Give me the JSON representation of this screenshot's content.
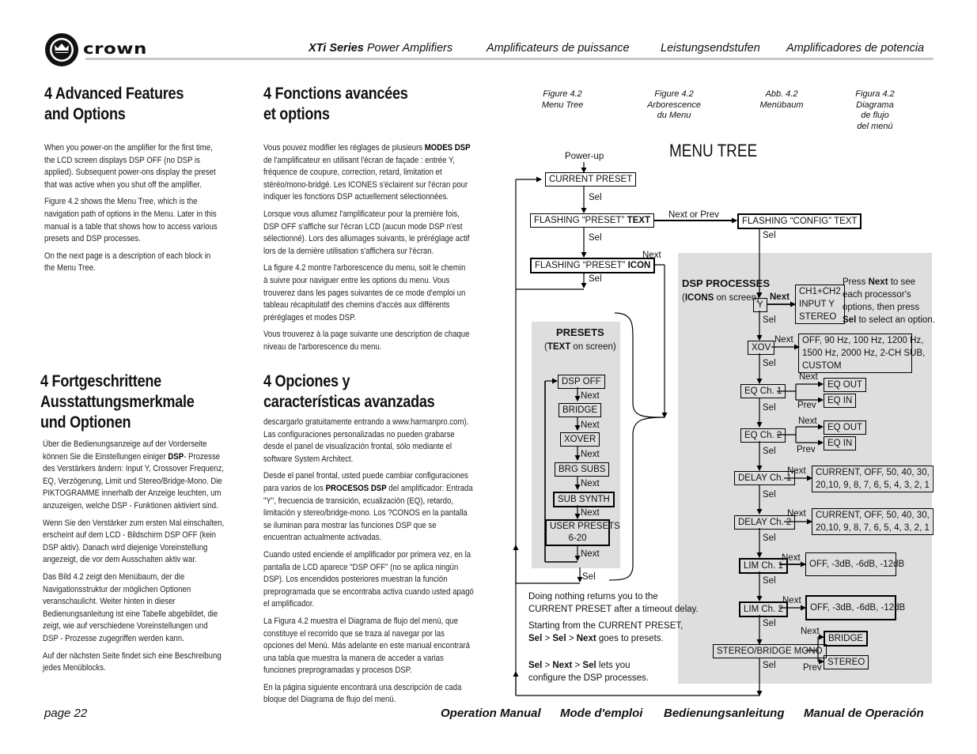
{
  "header": {
    "brand": "crown",
    "series_bold": "XTi Series",
    "series_rest": " Power Amplifiers",
    "fr": "Amplificateurs de puissance",
    "de": "Leistungsendstufen",
    "es": "Amplificadores de potencia"
  },
  "sections": {
    "en": {
      "title_line1": "4 Advanced Features",
      "title_line2": "and Options",
      "paragraphs": [
        "When you power-on the amplifier for the first time, the LCD screen displays DSP OFF (no DSP is applied). Subsequent power-ons display the preset that was active when you shut off the amplifier.",
        "Figure 4.2 shows the Menu Tree, which is the navigation path of options in the Menu. Later in this manual is a table that shows how to access various presets and DSP processes.",
        "On the next page is a description of each block in the Menu Tree."
      ]
    },
    "fr": {
      "title_line1": "4 Fonctions avancées",
      "title_line2": "et options",
      "p1_pre": "Vous pouvez modifier les réglages de plusieurs ",
      "p1_bold": "MODES DSP",
      "p1_post": " de l'amplificateur en utilisant l'écran de façade : entrée Y, fréquence de coupure, correction, retard, limitation et stéréo/mono-bridgé. Les ICONES s'éclairent sur l'écran pour indiquer les fonctions DSP actuellement sélectionnées.",
      "paragraphs": [
        "Lorsque vous allumez l'amplificateur pour la première fois, DSP OFF s'affiche sur l'écran LCD (aucun mode DSP n'est sélectionné). Lors des allumages suivants, le préréglage actif lors de la dernière utilisation s'affichera sur l'écran.",
        "La figure 4.2 montre l'arborescence du menu, soit le chemin à suivre pour naviguer entre les options du menu. Vous trouverez dans les pages suivantes de ce mode d'emploi un tableau récapitulatif des chemins d'accès aux différents préréglages et modes DSP.",
        "Vous trouverez à la page suivante une description de chaque niveau de l'arborescence du menu."
      ]
    },
    "de": {
      "title_line1": "4 Fortgeschrittene",
      "title_line2": "Ausstattungsmerkmale",
      "title_line3": "und Optionen",
      "p1_pre": "Über die Bedienungsanzeige auf der Vorderseite können Sie die Einstellungen einiger ",
      "p1_bold": "DSP",
      "p1_post": "- Prozesse des Verstärkers ändern: Input Y, Crossover Frequenz, EQ, Verzögerung, Limit und Stereo/Bridge-Mono. Die PIKTOGRAMME innerhalb der Anzeige leuchten, um anzuzeigen, welche DSP - Funktionen aktiviert sind.",
      "paragraphs": [
        "Wenn Sie den Verstärker zum ersten Mal einschalten, erscheint auf dem LCD - Bildschirm DSP OFF (kein DSP aktiv). Danach wird diejenige Voreinstellung angezeigt, die vor dem Ausschalten aktiv war.",
        "Das Bild 4.2 zeigt den Menübaum, der die Navigationsstruktur der möglichen Optionen veranschaulicht. Weiter hinten in dieser Bedienungsanleitung ist eine Tabelle abgebildet, die zeigt, wie auf verschiedene Voreinstellungen und DSP - Prozesse zugegriffen werden kann.",
        "Auf der nächsten Seite findet sich eine Beschreibung jedes Menüblocks."
      ]
    },
    "es": {
      "title_line1": "4 Opciones y",
      "title_line2": "características avanzadas",
      "p0": "descargarlo gratuitamente entrando a www.harmanpro.com). Las configuraciones personalizadas no pueden grabarse desde el panel de visualización frontal, sólo mediante el software System Architect.",
      "p1_pre": "Desde el panel frontal, usted puede cambiar configuraciones para varios de los ",
      "p1_bold": "PROCESOS DSP",
      "p1_post": " del amplificador: Entrada \"Y\", frecuencia de transición, ecualización (EQ), retardo, limitación y stereo/bridge-mono. Los ?CONOS en la pantalla se iluminan para mostrar las funciones DSP que se encuentran actualmente activadas.",
      "paragraphs": [
        "Cuando usted enciende el amplificador por primera vez, en la pantalla de LCD aparece \"DSP OFF\" (no se aplica ningún DSP). Los encendidos posteriores muestran la función preprogramada que se encontraba activa cuando usted apagó el amplificador.",
        "La Figura 4.2 muestra el Diagrama de flujo del menú, que constituye el recorrido que se traza al navegar por las opciones del Menú. Más adelante en este manual encontrará una tabla que muestra la manera de acceder a varias funciones preprogramadas y procesos DSP.",
        "En la página siguiente encontrará una descripción de cada bloque del Diagrama de flujo del menú."
      ]
    }
  },
  "figure": {
    "captions": [
      "Figure 4.2\nMenu Tree",
      "Figure 4.2\nArborescence\ndu Menu",
      "Abb. 4.2\nMenübaum",
      "Figura 4.2\nDiagrama\nde flujo\ndel menú"
    ],
    "title": "MENU TREE",
    "power_up": "Power-up",
    "current_preset": "CURRENT PRESET",
    "flashing_preset_text_pre": "FLASHING “PRESET” ",
    "flashing_preset_text_bold": "TEXT",
    "flashing_preset_icon_pre": "FLASHING “PRESET” ",
    "flashing_preset_icon_bold": "ICON",
    "flashing_config_text": "FLASHING “CONFIG” TEXT",
    "next_or_prev": "Next or Prev",
    "sel": "Sel",
    "next": "Next",
    "prev": "Prev",
    "presets": {
      "title": "PRESETS",
      "sub_bold": "TEXT",
      "sub_rest": " on screen)",
      "sub_open": "(",
      "items": [
        "DSP OFF",
        "BRIDGE",
        "XOVER",
        "BRG SUBS",
        "SUB SYNTH",
        "USER PRESETS",
        "6-20"
      ]
    },
    "dsp": {
      "title": "DSP PROCESSES",
      "sub_open": "(",
      "sub_bold": "ICONS",
      "sub_rest": " on screen)",
      "help_l1_pre": "Press ",
      "help_l1_bold": "Next",
      "help_l1_post": " to see",
      "help_l2": "each processor's",
      "help_l3": "options, then press",
      "help_l4_bold": "Sel",
      "help_l4_post": " to select an option.",
      "y": "Y",
      "y_opts": [
        "CH1+CH2",
        "INPUT Y",
        "STEREO"
      ],
      "xov": "XOV",
      "xov_opts": [
        "OFF, 90 Hz, 100 Hz, 1200 Hz,",
        "1500 Hz, 2000 Hz, 2-CH SUB,",
        "CUSTOM"
      ],
      "eq1": "EQ Ch. 1",
      "eq2": "EQ Ch. 2",
      "eq_out": "EQ OUT",
      "eq_in": "EQ IN",
      "delay1": "DELAY Ch. 1",
      "delay2": "DELAY Ch. 2",
      "delay_opts": [
        "CURRENT, OFF, 50, 40, 30,",
        "20,10, 9, 8, 7, 6, 5, 4, 3, 2, 1"
      ],
      "lim1": "LIM Ch. 1",
      "lim2": "LIM Ch. 2",
      "lim_opts": "OFF, -3dB, -6dB, -12dB",
      "stereo_bridge": "STEREO/BRIDGE MONO",
      "bridge": "BRIDGE",
      "stereo": "STEREO"
    },
    "notes": {
      "l1": "Doing nothing returns you to the",
      "l2": "CURRENT PRESET after a timeout delay.",
      "l3": "Starting from the CURRENT PRESET,",
      "l4_b1": "Sel",
      "l4_gt": " > ",
      "l4_b2": "Sel",
      "l4_b3": "Next",
      "l4_rest": " goes to presets.",
      "l5_b1": "Sel",
      "l5_b2": "Next",
      "l5_b3": "Sel",
      "l5_rest": " lets you",
      "l6": "configure the DSP processes."
    }
  },
  "footer": {
    "page": "page 22",
    "items": [
      "Operation Manual",
      "Mode d'emploi",
      "Bedienungsanleitung",
      "Manual de Operación"
    ]
  }
}
